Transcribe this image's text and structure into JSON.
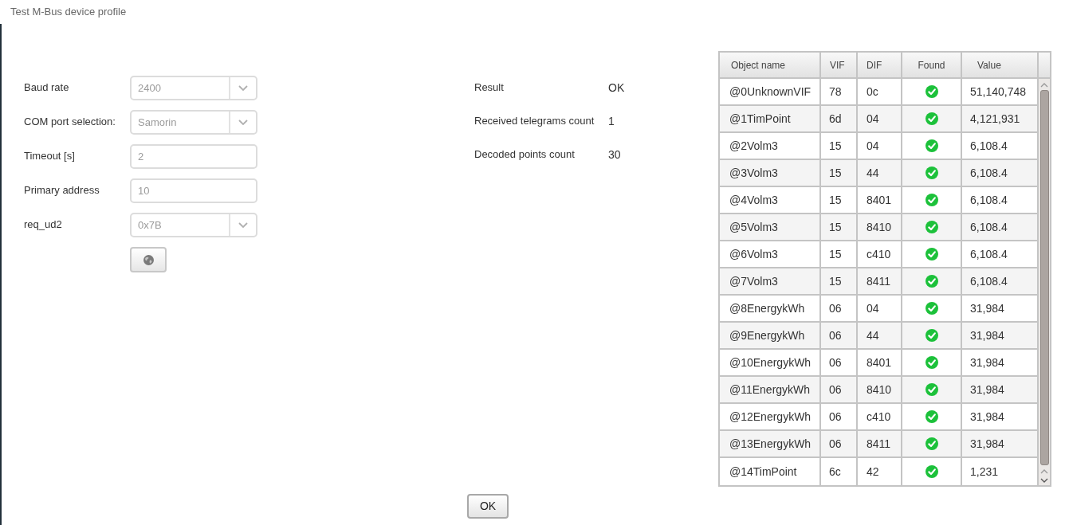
{
  "window": {
    "title": "Test M-Bus device profile"
  },
  "form": {
    "fields": [
      {
        "label": "Baud rate",
        "kind": "select",
        "value": "2400",
        "disabled": true
      },
      {
        "label": "COM port selection:",
        "kind": "select",
        "value": "Samorin",
        "disabled": true
      },
      {
        "label": "Timeout [s]",
        "kind": "text",
        "value": "2",
        "disabled": true
      },
      {
        "label": "Primary address",
        "kind": "text",
        "value": "10",
        "disabled": true
      },
      {
        "label": "req_ud2",
        "kind": "select",
        "value": "0x7B",
        "disabled": true
      }
    ]
  },
  "results": [
    {
      "label": "Result",
      "value": "OK"
    },
    {
      "label": "Received telegrams count",
      "value": "1"
    },
    {
      "label": "Decoded points count",
      "value": "30"
    }
  ],
  "table": {
    "columns": [
      "Object name",
      "VIF",
      "DIF",
      "Found",
      "Value"
    ],
    "rows": [
      {
        "object_name": "@0UnknownVIF",
        "vif": "78",
        "dif": "0c",
        "found": true,
        "value": "51,140,748"
      },
      {
        "object_name": "@1TimPoint",
        "vif": "6d",
        "dif": "04",
        "found": true,
        "value": "4,121,931"
      },
      {
        "object_name": "@2Volm3",
        "vif": "15",
        "dif": "04",
        "found": true,
        "value": "6,108.4"
      },
      {
        "object_name": "@3Volm3",
        "vif": "15",
        "dif": "44",
        "found": true,
        "value": "6,108.4"
      },
      {
        "object_name": "@4Volm3",
        "vif": "15",
        "dif": "8401",
        "found": true,
        "value": "6,108.4"
      },
      {
        "object_name": "@5Volm3",
        "vif": "15",
        "dif": "8410",
        "found": true,
        "value": "6,108.4"
      },
      {
        "object_name": "@6Volm3",
        "vif": "15",
        "dif": "c410",
        "found": true,
        "value": "6,108.4"
      },
      {
        "object_name": "@7Volm3",
        "vif": "15",
        "dif": "8411",
        "found": true,
        "value": "6,108.4"
      },
      {
        "object_name": "@8EnergykWh",
        "vif": "06",
        "dif": "04",
        "found": true,
        "value": "31,984"
      },
      {
        "object_name": "@9EnergykWh",
        "vif": "06",
        "dif": "44",
        "found": true,
        "value": "31,984"
      },
      {
        "object_name": "@10EnergykWh",
        "vif": "06",
        "dif": "8401",
        "found": true,
        "value": "31,984"
      },
      {
        "object_name": "@11EnergykWh",
        "vif": "06",
        "dif": "8410",
        "found": true,
        "value": "31,984"
      },
      {
        "object_name": "@12EnergykWh",
        "vif": "06",
        "dif": "c410",
        "found": true,
        "value": "31,984"
      },
      {
        "object_name": "@13EnergykWh",
        "vif": "06",
        "dif": "8411",
        "found": true,
        "value": "31,984"
      },
      {
        "object_name": "@14TimPoint",
        "vif": "6c",
        "dif": "42",
        "found": true,
        "value": "1,231"
      }
    ]
  },
  "footer": {
    "ok_button": "OK"
  }
}
